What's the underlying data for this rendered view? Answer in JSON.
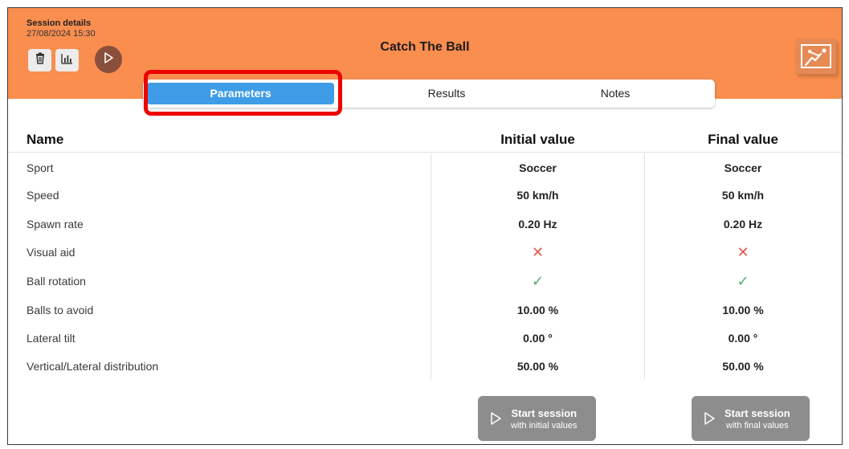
{
  "header": {
    "session_label": "Session details",
    "session_date": "27/08/2024 15:30",
    "title": "Catch The Ball",
    "accent_color": "#f98e4f",
    "icons": [
      "trash-icon",
      "bar-chart-icon",
      "play-icon",
      "catch-ball-logo-icon"
    ]
  },
  "tabs": {
    "items": [
      {
        "label": "Parameters",
        "active": true
      },
      {
        "label": "Results",
        "active": false
      },
      {
        "label": "Notes",
        "active": false
      }
    ],
    "active_color": "#3f9ce6",
    "highlight_color": "#ee0000"
  },
  "table": {
    "headers": {
      "name": "Name",
      "initial": "Initial value",
      "final": "Final value"
    },
    "rows": [
      {
        "name": "Sport",
        "initial": "Soccer",
        "final": "Soccer"
      },
      {
        "name": "Speed",
        "initial": "50 km/h",
        "final": "50 km/h"
      },
      {
        "name": "Spawn rate",
        "initial": "0.20 Hz",
        "final": "0.20 Hz"
      },
      {
        "name": "Visual aid",
        "initial": "✕",
        "final": "✕",
        "icon": "cross-icon"
      },
      {
        "name": "Ball rotation",
        "initial": "✓",
        "final": "✓",
        "icon": "check-icon"
      },
      {
        "name": "Balls to avoid",
        "initial": "10.00 %",
        "final": "10.00 %"
      },
      {
        "name": "Lateral tilt",
        "initial": "0.00 °",
        "final": "0.00 °"
      },
      {
        "name": "Vertical/Lateral distribution",
        "initial": "50.00 %",
        "final": "50.00 %"
      }
    ]
  },
  "buttons": {
    "start_initial": {
      "line1": "Start session",
      "line2": "with initial values"
    },
    "start_final": {
      "line1": "Start session",
      "line2": "with final values"
    }
  }
}
